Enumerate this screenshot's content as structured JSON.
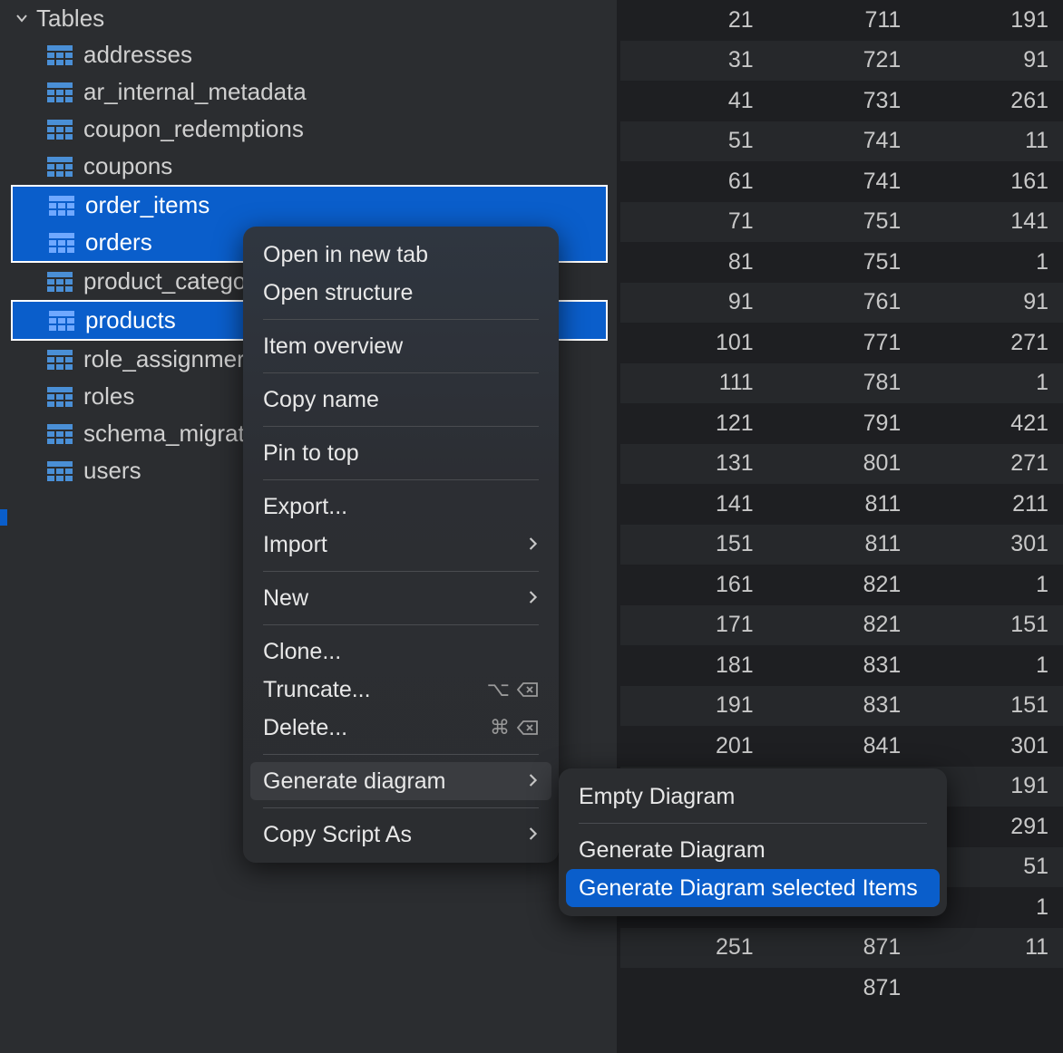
{
  "sidebar": {
    "folder_label": "Tables",
    "tables": [
      {
        "name": "addresses",
        "selected": false
      },
      {
        "name": "ar_internal_metadata",
        "selected": false
      },
      {
        "name": "coupon_redemptions",
        "selected": false
      },
      {
        "name": "coupons",
        "selected": false
      },
      {
        "name": "order_items",
        "selected": true
      },
      {
        "name": "orders",
        "selected": true
      },
      {
        "name": "product_catego",
        "selected": false
      },
      {
        "name": "products",
        "selected": true
      },
      {
        "name": "role_assignmer",
        "selected": false
      },
      {
        "name": "roles",
        "selected": false
      },
      {
        "name": "schema_migrat",
        "selected": false
      },
      {
        "name": "users",
        "selected": false
      }
    ]
  },
  "grid": {
    "rows": [
      [
        21,
        711,
        191
      ],
      [
        31,
        721,
        91
      ],
      [
        41,
        731,
        261
      ],
      [
        51,
        741,
        11
      ],
      [
        61,
        741,
        161
      ],
      [
        71,
        751,
        141
      ],
      [
        81,
        751,
        1
      ],
      [
        91,
        761,
        91
      ],
      [
        101,
        771,
        271
      ],
      [
        111,
        781,
        1
      ],
      [
        121,
        791,
        421
      ],
      [
        131,
        801,
        271
      ],
      [
        141,
        811,
        211
      ],
      [
        151,
        811,
        301
      ],
      [
        161,
        821,
        1
      ],
      [
        171,
        821,
        151
      ],
      [
        181,
        831,
        1
      ],
      [
        191,
        831,
        151
      ],
      [
        201,
        841,
        301
      ],
      [
        "",
        "",
        191
      ],
      [
        "",
        "",
        291
      ],
      [
        "",
        "",
        51
      ],
      [
        "",
        "",
        1
      ],
      [
        251,
        871,
        11
      ],
      [
        "",
        871,
        ""
      ]
    ]
  },
  "context_menu": {
    "items": [
      {
        "label": "Open in new tab",
        "submenu": false
      },
      {
        "label": "Open structure",
        "submenu": false
      },
      {
        "sep": true
      },
      {
        "label": "Item overview",
        "submenu": false
      },
      {
        "sep": true
      },
      {
        "label": "Copy name",
        "submenu": false
      },
      {
        "sep": true
      },
      {
        "label": "Pin to top",
        "submenu": false
      },
      {
        "sep": true
      },
      {
        "label": "Export...",
        "submenu": false
      },
      {
        "label": "Import",
        "submenu": true
      },
      {
        "sep": true
      },
      {
        "label": "New",
        "submenu": true
      },
      {
        "sep": true
      },
      {
        "label": "Clone...",
        "submenu": false
      },
      {
        "label": "Truncate...",
        "submenu": false,
        "shortcut": "opt-del"
      },
      {
        "label": "Delete...",
        "submenu": false,
        "shortcut": "cmd-del"
      },
      {
        "sep": true
      },
      {
        "label": "Generate diagram",
        "submenu": true,
        "highlight": true
      },
      {
        "sep": true
      },
      {
        "label": "Copy Script As",
        "submenu": true
      }
    ]
  },
  "submenu": {
    "items": [
      {
        "label": "Empty Diagram",
        "active": false
      },
      {
        "sep": true
      },
      {
        "label": "Generate Diagram",
        "active": false
      },
      {
        "label": "Generate Diagram selected Items",
        "active": true
      }
    ]
  }
}
